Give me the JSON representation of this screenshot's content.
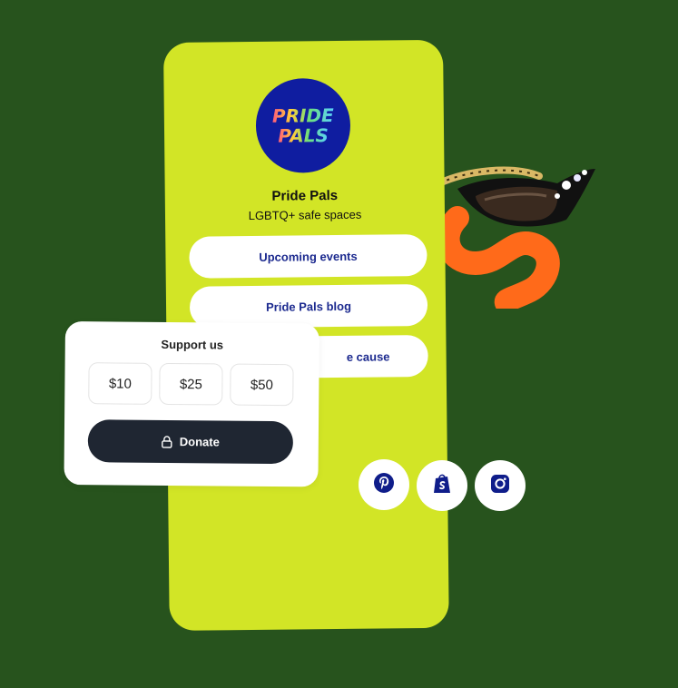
{
  "profile": {
    "logo_line1": "PRIDE",
    "logo_line2": "PALS",
    "name": "Pride Pals",
    "tagline": "LGBTQ+ safe spaces"
  },
  "links": [
    {
      "label": "Upcoming events"
    },
    {
      "label": "Pride Pals blog"
    },
    {
      "label": "e cause"
    }
  ],
  "support": {
    "title": "Support us",
    "amounts": [
      "$10",
      "$25",
      "$50"
    ],
    "donate_label": "Donate"
  },
  "social": [
    {
      "icon": "pinterest-icon"
    },
    {
      "icon": "shopify-icon"
    },
    {
      "icon": "instagram-icon"
    }
  ],
  "colors": {
    "background": "#27531d",
    "card": "#d2e526",
    "avatar": "#0f1da0",
    "link_text": "#1c2a8f",
    "donate_button": "#1f2632"
  }
}
